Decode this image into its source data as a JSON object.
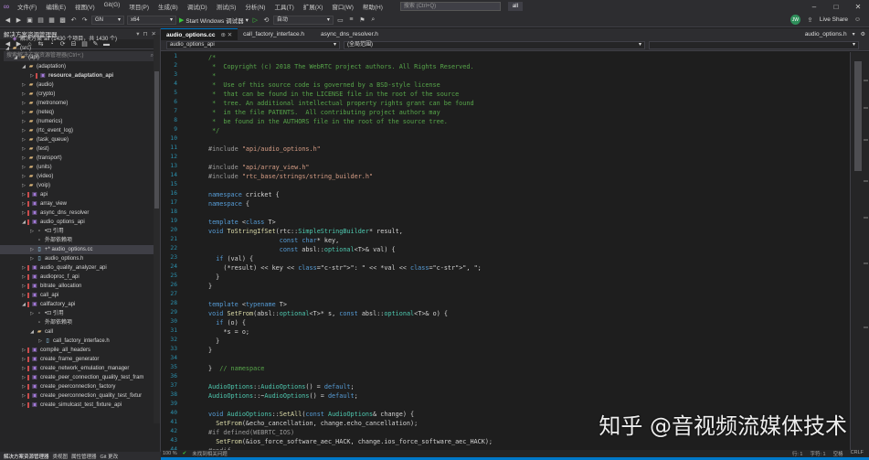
{
  "menubar": {
    "items": [
      "文件(F)",
      "编辑(E)",
      "视图(V)",
      "Git(G)",
      "项目(P)",
      "生成(B)",
      "调试(D)",
      "测试(S)",
      "分析(N)",
      "工具(T)",
      "扩展(X)",
      "窗口(W)",
      "帮助(H)"
    ],
    "search_placeholder": "搜索 (Ctrl+Q)",
    "solution_name": "all"
  },
  "toolbar": {
    "config": "GN",
    "platform": "x64",
    "run_label": "Start Windows 调试器",
    "startup_item": "自动",
    "avatar_initials": "JW",
    "live_share": "Live Share"
  },
  "solution_explorer": {
    "title": "解决方案资源管理器",
    "search_placeholder": "搜索解决方案资源管理器(Ctrl+;)",
    "tree": [
      {
        "depth": 0,
        "arrow": "",
        "icon": "sol",
        "label": "解决方案\"all\"(1430 个项目，共 1430 个)",
        "red": false
      },
      {
        "depth": 0,
        "arrow": "◢",
        "icon": "folder",
        "label": "(src)",
        "red": false
      },
      {
        "depth": 1,
        "arrow": "◢",
        "icon": "folder",
        "label": "(api)",
        "red": false
      },
      {
        "depth": 2,
        "arrow": "◢",
        "icon": "folder",
        "label": "(adaptation)",
        "red": false
      },
      {
        "depth": 3,
        "arrow": "▷",
        "icon": "proj",
        "label": "resource_adaptation_api",
        "red": true,
        "bold": true
      },
      {
        "depth": 2,
        "arrow": "▷",
        "icon": "folder",
        "label": "(audio)",
        "red": false
      },
      {
        "depth": 2,
        "arrow": "▷",
        "icon": "folder",
        "label": "(crypto)",
        "red": false
      },
      {
        "depth": 2,
        "arrow": "▷",
        "icon": "folder",
        "label": "(metronome)",
        "red": false
      },
      {
        "depth": 2,
        "arrow": "▷",
        "icon": "folder",
        "label": "(neteq)",
        "red": false
      },
      {
        "depth": 2,
        "arrow": "▷",
        "icon": "folder",
        "label": "(numerics)",
        "red": false
      },
      {
        "depth": 2,
        "arrow": "▷",
        "icon": "folder",
        "label": "(rtc_event_log)",
        "red": false
      },
      {
        "depth": 2,
        "arrow": "▷",
        "icon": "folder",
        "label": "(task_queue)",
        "red": false
      },
      {
        "depth": 2,
        "arrow": "▷",
        "icon": "folder",
        "label": "(test)",
        "red": false
      },
      {
        "depth": 2,
        "arrow": "▷",
        "icon": "folder",
        "label": "(transport)",
        "red": false
      },
      {
        "depth": 2,
        "arrow": "▷",
        "icon": "folder",
        "label": "(units)",
        "red": false
      },
      {
        "depth": 2,
        "arrow": "▷",
        "icon": "folder",
        "label": "(video)",
        "red": false
      },
      {
        "depth": 2,
        "arrow": "▷",
        "icon": "folder",
        "label": "(voip)",
        "red": false
      },
      {
        "depth": 2,
        "arrow": "▷",
        "icon": "proj",
        "label": "api",
        "red": true
      },
      {
        "depth": 2,
        "arrow": "▷",
        "icon": "proj",
        "label": "array_view",
        "red": true
      },
      {
        "depth": 2,
        "arrow": "▷",
        "icon": "proj",
        "label": "async_dns_resolver",
        "red": true
      },
      {
        "depth": 2,
        "arrow": "◢",
        "icon": "proj",
        "label": "audio_options_api",
        "red": true
      },
      {
        "depth": 3,
        "arrow": "▷",
        "icon": "ref",
        "label": "•⊡ 引用",
        "red": false
      },
      {
        "depth": 3,
        "arrow": "",
        "icon": "ref",
        "label": "外部依赖项",
        "red": false
      },
      {
        "depth": 3,
        "arrow": "▷",
        "icon": "cpp",
        "label": "+* audio_options.cc",
        "red": false,
        "selected": true
      },
      {
        "depth": 3,
        "arrow": "▷",
        "icon": "cpp",
        "label": "audio_options.h",
        "red": false
      },
      {
        "depth": 2,
        "arrow": "▷",
        "icon": "proj",
        "label": "audio_quality_analyzer_api",
        "red": true
      },
      {
        "depth": 2,
        "arrow": "▷",
        "icon": "proj",
        "label": "audioproc_f_api",
        "red": true
      },
      {
        "depth": 2,
        "arrow": "▷",
        "icon": "proj",
        "label": "bitrate_allocation",
        "red": true
      },
      {
        "depth": 2,
        "arrow": "▷",
        "icon": "proj",
        "label": "call_api",
        "red": true
      },
      {
        "depth": 2,
        "arrow": "◢",
        "icon": "proj",
        "label": "callfactory_api",
        "red": true
      },
      {
        "depth": 3,
        "arrow": "▷",
        "icon": "ref",
        "label": "•⊡ 引用",
        "red": false
      },
      {
        "depth": 3,
        "arrow": "",
        "icon": "ref",
        "label": "外部依赖项",
        "red": false
      },
      {
        "depth": 3,
        "arrow": "◢",
        "icon": "folder",
        "label": "call",
        "red": false
      },
      {
        "depth": 4,
        "arrow": "▷",
        "icon": "cpp",
        "label": "call_factory_interface.h",
        "red": false
      },
      {
        "depth": 2,
        "arrow": "▷",
        "icon": "proj",
        "label": "compile_all_headers",
        "red": true
      },
      {
        "depth": 2,
        "arrow": "▷",
        "icon": "proj",
        "label": "create_frame_generator",
        "red": true
      },
      {
        "depth": 2,
        "arrow": "▷",
        "icon": "proj",
        "label": "create_network_emulation_manager",
        "red": true
      },
      {
        "depth": 2,
        "arrow": "▷",
        "icon": "proj",
        "label": "create_peer_connection_quality_test_fram",
        "red": true
      },
      {
        "depth": 2,
        "arrow": "▷",
        "icon": "proj",
        "label": "create_peerconnection_factory",
        "red": true
      },
      {
        "depth": 2,
        "arrow": "▷",
        "icon": "proj",
        "label": "create_peerconnection_quality_test_fixtur",
        "red": true
      },
      {
        "depth": 2,
        "arrow": "▷",
        "icon": "proj",
        "label": "create_simulcast_test_fixture_api",
        "red": true
      }
    ],
    "bottom_tabs": [
      "解决方案资源管理器",
      "类视图",
      "属性管理器",
      "Git 更改"
    ]
  },
  "editor": {
    "tabs": [
      {
        "label": "audio_options.cc",
        "active": true
      },
      {
        "label": "call_factory_interface.h",
        "active": false
      },
      {
        "label": "async_dns_resolver.h",
        "active": false
      }
    ],
    "right_tab": "audio_options.h",
    "nav_project": "audio_options_api",
    "nav_scope": "(全局范围)",
    "lines": [
      {
        "n": "1",
        "t": "/*",
        "k": "com"
      },
      {
        "n": "2",
        "t": " *  Copyright (c) 2018 The WebRTC project authors. All Rights Reserved.",
        "k": "com"
      },
      {
        "n": "3",
        "t": " *",
        "k": "com"
      },
      {
        "n": "4",
        "t": " *  Use of this source code is governed by a BSD-style license",
        "k": "com"
      },
      {
        "n": "5",
        "t": " *  that can be found in the LICENSE file in the root of the source",
        "k": "com"
      },
      {
        "n": "6",
        "t": " *  tree. An additional intellectual property rights grant can be found",
        "k": "com"
      },
      {
        "n": "7",
        "t": " *  in the file PATENTS.  All contributing project authors may",
        "k": "com"
      },
      {
        "n": "8",
        "t": " *  be found in the AUTHORS file in the root of the source tree.",
        "k": "com"
      },
      {
        "n": "9",
        "t": " */",
        "k": "com"
      },
      {
        "n": "10",
        "t": "",
        "k": ""
      },
      {
        "n": "11",
        "t": "#include \"api/audio_options.h\"",
        "k": "inc"
      },
      {
        "n": "12",
        "t": "",
        "k": ""
      },
      {
        "n": "13",
        "t": "#include \"api/array_view.h\"",
        "k": "inc"
      },
      {
        "n": "14",
        "t": "#include \"rtc_base/strings/string_builder.h\"",
        "k": "inc"
      },
      {
        "n": "15",
        "t": "",
        "k": ""
      },
      {
        "n": "16",
        "t": "namespace cricket {",
        "k": "ns"
      },
      {
        "n": "17",
        "t": "namespace {",
        "k": "ns"
      },
      {
        "n": "18",
        "t": "",
        "k": ""
      },
      {
        "n": "19",
        "t": "template <class T>",
        "k": "tpl"
      },
      {
        "n": "20",
        "t": "void ToStringIfSet(rtc::SimpleStringBuilder* result,",
        "k": "code"
      },
      {
        "n": "21",
        "t": "                   const char* key,",
        "k": "code"
      },
      {
        "n": "22",
        "t": "                   const absl::optional<T>& val) {",
        "k": "code"
      },
      {
        "n": "23",
        "t": "  if (val) {",
        "k": "code"
      },
      {
        "n": "24",
        "t": "    (*result) << key << \": \" << *val << \", \";",
        "k": "code"
      },
      {
        "n": "25",
        "t": "  }",
        "k": "code"
      },
      {
        "n": "26",
        "t": "}",
        "k": "code"
      },
      {
        "n": "27",
        "t": "",
        "k": ""
      },
      {
        "n": "28",
        "t": "template <typename T>",
        "k": "tpl"
      },
      {
        "n": "29",
        "t": "void SetFrom(absl::optional<T>* s, const absl::optional<T>& o) {",
        "k": "code"
      },
      {
        "n": "30",
        "t": "  if (o) {",
        "k": "code"
      },
      {
        "n": "31",
        "t": "    *s = o;",
        "k": "code"
      },
      {
        "n": "32",
        "t": "  }",
        "k": "code"
      },
      {
        "n": "33",
        "t": "}",
        "k": "code"
      },
      {
        "n": "34",
        "t": "",
        "k": ""
      },
      {
        "n": "35",
        "t": "}  // namespace",
        "k": "nsend"
      },
      {
        "n": "36",
        "t": "",
        "k": ""
      },
      {
        "n": "37",
        "t": "AudioOptions::AudioOptions() = default;",
        "k": "code"
      },
      {
        "n": "38",
        "t": "AudioOptions::~AudioOptions() = default;",
        "k": "code"
      },
      {
        "n": "39",
        "t": "",
        "k": ""
      },
      {
        "n": "40",
        "t": "void AudioOptions::SetAll(const AudioOptions& change) {",
        "k": "code"
      },
      {
        "n": "41",
        "t": "  SetFrom(&echo_cancellation, change.echo_cancellation);",
        "k": "code"
      },
      {
        "n": "42",
        "t": "#if defined(WEBRTC_IOS)",
        "k": "pp"
      },
      {
        "n": "43",
        "t": "  SetFrom(&ios_force_software_aec_HACK, change.ios_force_software_aec_HACK);",
        "k": "code"
      },
      {
        "n": "44",
        "t": "#endif",
        "k": "pp"
      }
    ],
    "status": {
      "zoom": "100 %",
      "issues": "未找到相关问题",
      "line": "行: 1",
      "col": "字符: 1",
      "ws": "空格",
      "eol": "CRLF"
    }
  },
  "watermark": "知乎 @音视频流媒体技术",
  "colors": {
    "accent": "#007acc",
    "bg": "#1e1e1e",
    "panel": "#252526",
    "comment": "#57a64a",
    "string": "#d69d85",
    "keyword": "#569cd6"
  }
}
